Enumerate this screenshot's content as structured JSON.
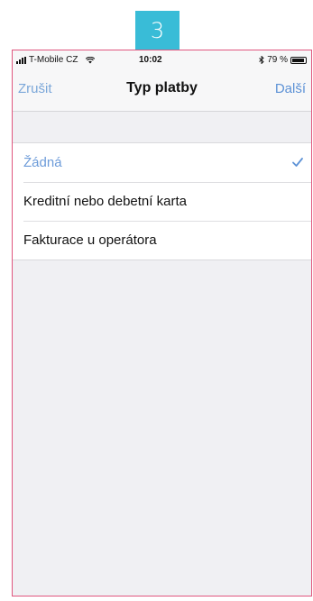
{
  "step": {
    "number": "3"
  },
  "status_bar": {
    "carrier": "T-Mobile CZ",
    "time": "10:02",
    "battery_text": "79 %",
    "battery_level": 0.79
  },
  "navbar": {
    "cancel_label": "Zrušit",
    "title": "Typ platby",
    "next_label": "Další"
  },
  "payment_options": [
    {
      "label": "Žádná",
      "selected": true
    },
    {
      "label": "Kreditní nebo debetní karta",
      "selected": false
    },
    {
      "label": "Fakturace u operátora",
      "selected": false
    }
  ],
  "colors": {
    "badge": "#39bcd7",
    "link": "#5d92d6",
    "frame": "#e0567e"
  }
}
